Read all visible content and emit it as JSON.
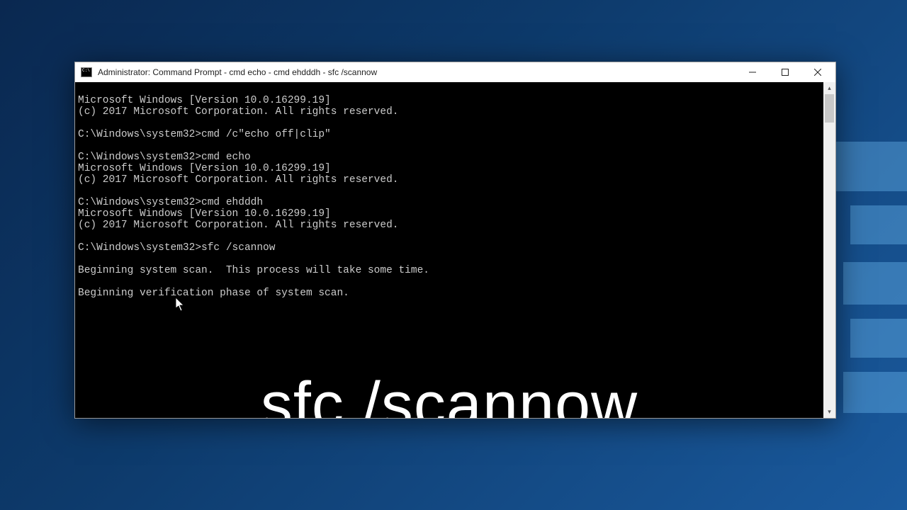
{
  "window": {
    "title": "Administrator: Command Prompt - cmd  echo - cmd  ehdddh - sfc  /scannow"
  },
  "terminal": {
    "lines": [
      "Microsoft Windows [Version 10.0.16299.19]",
      "(c) 2017 Microsoft Corporation. All rights reserved.",
      "",
      "C:\\Windows\\system32>cmd /c\"echo off|clip\"",
      "",
      "C:\\Windows\\system32>cmd echo",
      "Microsoft Windows [Version 10.0.16299.19]",
      "(c) 2017 Microsoft Corporation. All rights reserved.",
      "",
      "C:\\Windows\\system32>cmd ehdddh",
      "Microsoft Windows [Version 10.0.16299.19]",
      "(c) 2017 Microsoft Corporation. All rights reserved.",
      "",
      "C:\\Windows\\system32>sfc /scannow",
      "",
      "Beginning system scan.  This process will take some time.",
      "",
      "Beginning verification phase of system scan."
    ]
  },
  "overlay": {
    "text": "sfc /scannow"
  }
}
